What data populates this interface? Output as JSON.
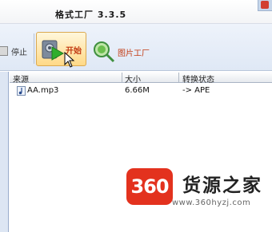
{
  "app": {
    "title": "格式工厂 3.3.5"
  },
  "toolbar": {
    "stop_label": "停止",
    "start_label": "开始",
    "picture_factory_label": "图片工厂"
  },
  "table": {
    "columns": [
      "来源",
      "大小",
      "转换状态"
    ],
    "rows": [
      {
        "source": "AA.mp3",
        "size": "6.66M",
        "status": "-> APE"
      }
    ]
  },
  "watermark": {
    "logo_text": "360",
    "name": "货源之家",
    "url": "www.360hyzj.com"
  },
  "colors": {
    "accent_red": "#e3321e",
    "toolbar_bg": "#e6edf7",
    "start_highlight": "#ffd987"
  },
  "icons": [
    "play-convert-icon",
    "stop-icon",
    "magnifier-globe-icon",
    "music-note-icon",
    "cursor-icon"
  ]
}
